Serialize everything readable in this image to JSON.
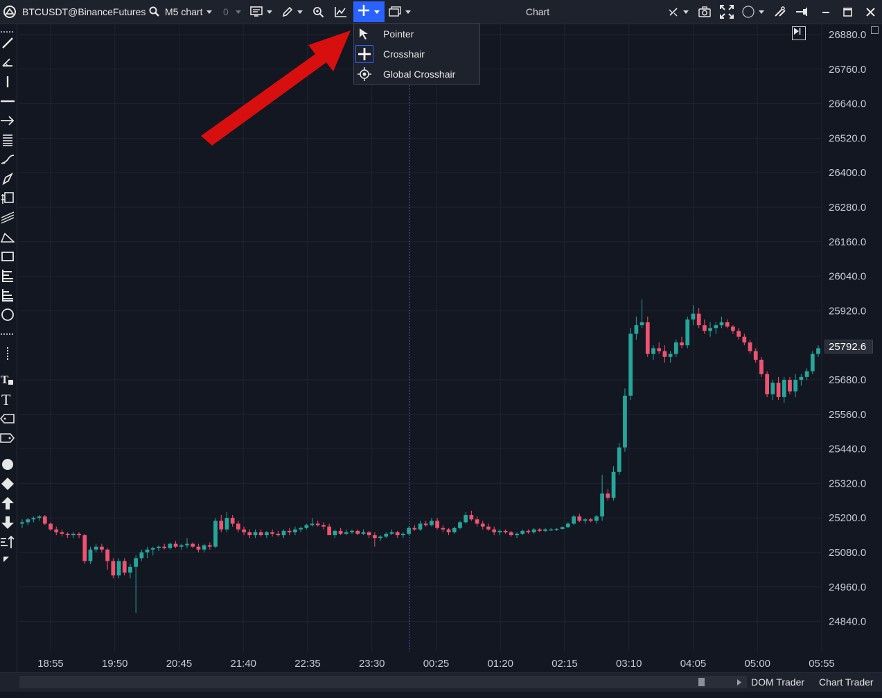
{
  "toolbar": {
    "instrument": "BTCUSDT@BinanceFutures",
    "chart_type": "M5 chart",
    "counter": "0",
    "window_title": "Chart"
  },
  "dropdown": {
    "items": [
      {
        "label": "Pointer",
        "icon": "pointer-arrow-icon"
      },
      {
        "label": "Crosshair",
        "icon": "crosshair-icon"
      },
      {
        "label": "Global Crosshair",
        "icon": "global-crosshair-icon"
      }
    ]
  },
  "price_scale": {
    "current_price": "25792.6",
    "ticks": [
      "26880.0",
      "26760.0",
      "26640.0",
      "26520.0",
      "26400.0",
      "26280.0",
      "26160.0",
      "26040.0",
      "25920.0",
      "25680.0",
      "25560.0",
      "25440.0",
      "25320.0",
      "25200.0",
      "25080.0",
      "24960.0",
      "24840.0"
    ]
  },
  "time_scale": {
    "ticks": [
      "18:55",
      "19:50",
      "20:45",
      "21:40",
      "22:35",
      "23:30",
      "00:25",
      "01:20",
      "02:15",
      "03:10",
      "04:05",
      "05:00",
      "05:55"
    ]
  },
  "bottom": {
    "dom_trader": "DOM Trader",
    "chart_trader": "Chart Trader"
  },
  "colors": {
    "background": "#131722",
    "up_candle": "#26a69a",
    "down_candle": "#ef5370",
    "accent": "#2962ff",
    "annotation_arrow": "#d80f0f"
  },
  "chart_data": {
    "type": "candlestick",
    "ylim": [
      24780,
      26920
    ],
    "candles_ohlc": [
      [
        25180,
        25195,
        25165,
        25185
      ],
      [
        25185,
        25200,
        25175,
        25195
      ],
      [
        25195,
        25205,
        25185,
        25200
      ],
      [
        25200,
        25210,
        25190,
        25205
      ],
      [
        25205,
        25210,
        25175,
        25180
      ],
      [
        25180,
        25185,
        25155,
        25160
      ],
      [
        25160,
        25170,
        25140,
        25150
      ],
      [
        25150,
        25160,
        25135,
        25145
      ],
      [
        25145,
        25150,
        25130,
        25140
      ],
      [
        25140,
        25150,
        25130,
        25145
      ],
      [
        25145,
        25150,
        25130,
        25140
      ],
      [
        25140,
        25145,
        25040,
        25050
      ],
      [
        25050,
        25100,
        25040,
        25090
      ],
      [
        25090,
        25110,
        25080,
        25100
      ],
      [
        25100,
        25110,
        25080,
        25090
      ],
      [
        25090,
        25095,
        25020,
        25050
      ],
      [
        25050,
        25060,
        24990,
        25000
      ],
      [
        25000,
        25060,
        24990,
        25050
      ],
      [
        25050,
        25060,
        25000,
        25010
      ],
      [
        25010,
        25040,
        24990,
        25030
      ],
      [
        25030,
        25070,
        24870,
        25060
      ],
      [
        25060,
        25090,
        25050,
        25080
      ],
      [
        25080,
        25100,
        25060,
        25090
      ],
      [
        25090,
        25100,
        25070,
        25095
      ],
      [
        25095,
        25105,
        25085,
        25100
      ],
      [
        25100,
        25110,
        25090,
        25095
      ],
      [
        25095,
        25115,
        25090,
        25110
      ],
      [
        25110,
        25120,
        25095,
        25100
      ],
      [
        25100,
        25110,
        25090,
        25105
      ],
      [
        25105,
        25130,
        25095,
        25110
      ],
      [
        25110,
        25115,
        25095,
        25100
      ],
      [
        25100,
        25110,
        25080,
        25090
      ],
      [
        25090,
        25110,
        25080,
        25105
      ],
      [
        25105,
        25115,
        25090,
        25100
      ],
      [
        25100,
        25200,
        25095,
        25190
      ],
      [
        25190,
        25210,
        25150,
        25160
      ],
      [
        25160,
        25220,
        25150,
        25200
      ],
      [
        25200,
        25210,
        25170,
        25180
      ],
      [
        25180,
        25190,
        25150,
        25160
      ],
      [
        25160,
        25170,
        25140,
        25150
      ],
      [
        25150,
        25160,
        25130,
        25140
      ],
      [
        25140,
        25160,
        25130,
        25150
      ],
      [
        25150,
        25160,
        25135,
        25140
      ],
      [
        25140,
        25155,
        25130,
        25150
      ],
      [
        25150,
        25160,
        25135,
        25145
      ],
      [
        25145,
        25155,
        25135,
        25140
      ],
      [
        25140,
        25160,
        25130,
        25155
      ],
      [
        25155,
        25165,
        25140,
        25150
      ],
      [
        25150,
        25170,
        25140,
        25160
      ],
      [
        25160,
        25170,
        25150,
        25165
      ],
      [
        25165,
        25180,
        25160,
        25175
      ],
      [
        25175,
        25200,
        25170,
        25180
      ],
      [
        25180,
        25190,
        25170,
        25175
      ],
      [
        25175,
        25185,
        25160,
        25170
      ],
      [
        25170,
        25180,
        25150,
        25140
      ],
      [
        25140,
        25160,
        25130,
        25155
      ],
      [
        25155,
        25165,
        25140,
        25145
      ],
      [
        25145,
        25160,
        25140,
        25150
      ],
      [
        25150,
        25160,
        25145,
        25155
      ],
      [
        25155,
        25160,
        25140,
        25145
      ],
      [
        25145,
        25160,
        25140,
        25150
      ],
      [
        25150,
        25155,
        25130,
        25140
      ],
      [
        25140,
        25150,
        25100,
        25130
      ],
      [
        25130,
        25140,
        25120,
        25135
      ],
      [
        25135,
        25150,
        25130,
        25145
      ],
      [
        25145,
        25160,
        25140,
        25150
      ],
      [
        25150,
        25155,
        25130,
        25140
      ],
      [
        25140,
        25150,
        25130,
        25145
      ],
      [
        25145,
        25170,
        25140,
        25165
      ],
      [
        25165,
        25175,
        25155,
        25160
      ],
      [
        25160,
        25190,
        25155,
        25180
      ],
      [
        25180,
        25190,
        25170,
        25175
      ],
      [
        25175,
        25200,
        25170,
        25190
      ],
      [
        25190,
        25200,
        25160,
        25165
      ],
      [
        25165,
        25175,
        25150,
        25160
      ],
      [
        25160,
        25165,
        25140,
        25150
      ],
      [
        25150,
        25170,
        25145,
        25165
      ],
      [
        25165,
        25190,
        25160,
        25185
      ],
      [
        25185,
        25220,
        25180,
        25210
      ],
      [
        25210,
        25225,
        25190,
        25195
      ],
      [
        25195,
        25205,
        25170,
        25180
      ],
      [
        25180,
        25190,
        25160,
        25170
      ],
      [
        25170,
        25180,
        25155,
        25160
      ],
      [
        25160,
        25170,
        25140,
        25150
      ],
      [
        25150,
        25160,
        25140,
        25155
      ],
      [
        25155,
        25160,
        25145,
        25150
      ],
      [
        25150,
        25155,
        25135,
        25140
      ],
      [
        25140,
        25150,
        25130,
        25145
      ],
      [
        25145,
        25160,
        25140,
        25155
      ],
      [
        25155,
        25160,
        25145,
        25150
      ],
      [
        25150,
        25165,
        25145,
        25160
      ],
      [
        25160,
        25165,
        25150,
        25155
      ],
      [
        25155,
        25165,
        25150,
        25160
      ],
      [
        25160,
        25165,
        25155,
        25160
      ],
      [
        25160,
        25165,
        25155,
        25162
      ],
      [
        25162,
        25170,
        25160,
        25168
      ],
      [
        25168,
        25185,
        25165,
        25180
      ],
      [
        25180,
        25210,
        25175,
        25205
      ],
      [
        25205,
        25215,
        25185,
        25190
      ],
      [
        25190,
        25200,
        25180,
        25195
      ],
      [
        25195,
        25200,
        25185,
        25190
      ],
      [
        25190,
        25210,
        25180,
        25205
      ],
      [
        25205,
        25350,
        25190,
        25285
      ],
      [
        25285,
        25300,
        25260,
        25270
      ],
      [
        25270,
        25380,
        25260,
        25360
      ],
      [
        25360,
        25460,
        25350,
        25445
      ],
      [
        25445,
        25650,
        25430,
        25625
      ],
      [
        25625,
        25860,
        25610,
        25840
      ],
      [
        25840,
        25900,
        25820,
        25870
      ],
      [
        25870,
        25960,
        25860,
        25880
      ],
      [
        25880,
        25900,
        25760,
        25770
      ],
      [
        25770,
        25800,
        25750,
        25790
      ],
      [
        25790,
        25810,
        25770,
        25780
      ],
      [
        25780,
        25800,
        25740,
        25760
      ],
      [
        25760,
        25780,
        25740,
        25770
      ],
      [
        25770,
        25820,
        25760,
        25810
      ],
      [
        25810,
        25830,
        25790,
        25800
      ],
      [
        25800,
        25900,
        25790,
        25890
      ],
      [
        25890,
        25940,
        25870,
        25910
      ],
      [
        25910,
        25930,
        25860,
        25870
      ],
      [
        25870,
        25890,
        25840,
        25850
      ],
      [
        25850,
        25880,
        25830,
        25860
      ],
      [
        25860,
        25880,
        25840,
        25870
      ],
      [
        25870,
        25900,
        25860,
        25880
      ],
      [
        25880,
        25890,
        25860,
        25865
      ],
      [
        25865,
        25870,
        25840,
        25850
      ],
      [
        25850,
        25860,
        25820,
        25830
      ],
      [
        25830,
        25840,
        25800,
        25810
      ],
      [
        25810,
        25820,
        25770,
        25780
      ],
      [
        25780,
        25790,
        25740,
        25750
      ],
      [
        25750,
        25760,
        25690,
        25700
      ],
      [
        25700,
        25710,
        25620,
        25630
      ],
      [
        25630,
        25680,
        25610,
        25670
      ],
      [
        25670,
        25690,
        25610,
        25620
      ],
      [
        25620,
        25690,
        25600,
        25680
      ],
      [
        25680,
        25690,
        25630,
        25640
      ],
      [
        25640,
        25700,
        25620,
        25680
      ],
      [
        25680,
        25700,
        25660,
        25690
      ],
      [
        25690,
        25720,
        25680,
        25710
      ],
      [
        25710,
        25780,
        25700,
        25770
      ],
      [
        25770,
        25800,
        25760,
        25790
      ]
    ]
  }
}
